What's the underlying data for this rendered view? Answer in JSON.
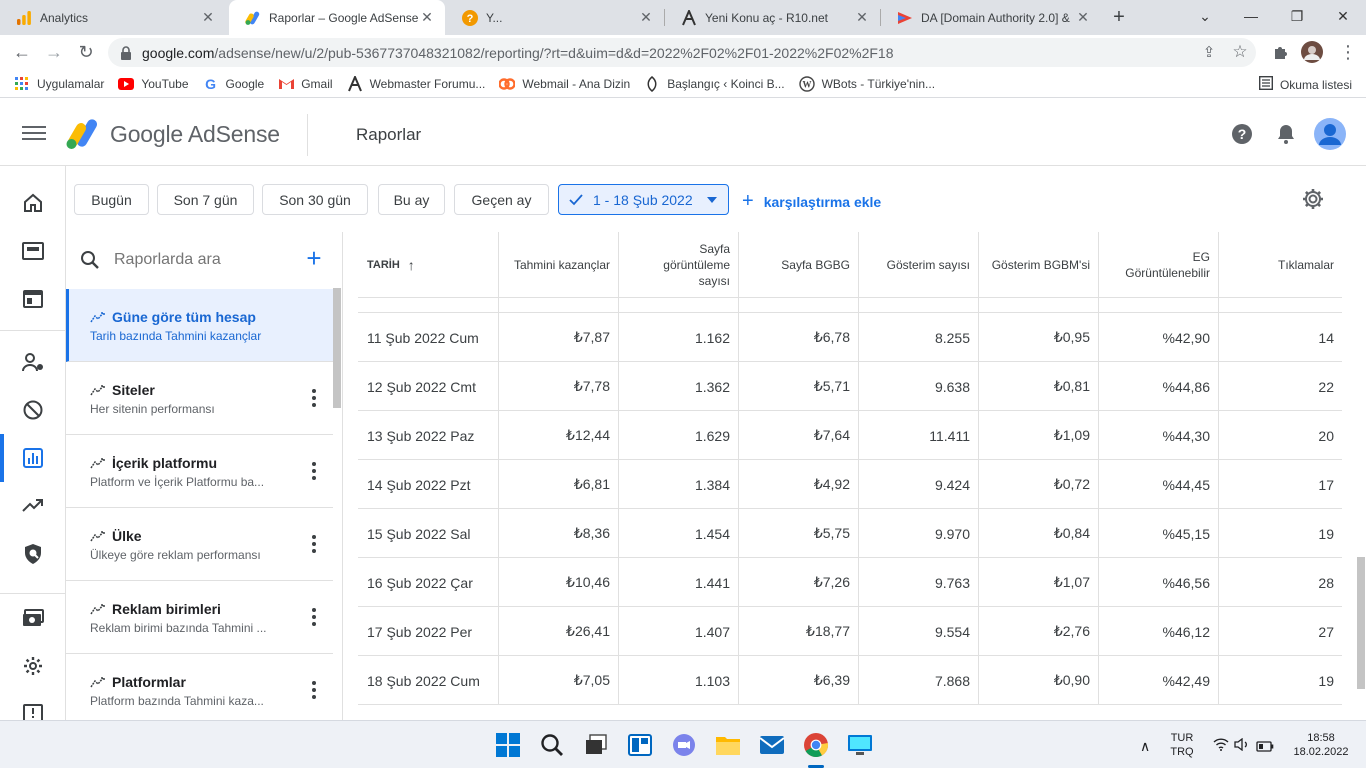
{
  "browser": {
    "tabs": [
      {
        "title": "Analytics",
        "icon": "analytics-icon",
        "active": false
      },
      {
        "title": "Raporlar – Google AdSense",
        "icon": "adsense-icon",
        "active": true
      },
      {
        "title": "Y...",
        "icon": "question-favicon",
        "active": false
      },
      {
        "title": "Yeni Konu aç - R10.net",
        "icon": "r10-favicon",
        "active": false
      },
      {
        "title": "DA [Domain Authority 2.0] &",
        "icon": "da-favicon",
        "active": false
      }
    ],
    "url_domain": "google.com",
    "url_path": "/adsense/new/u/2/pub-5367737048321082/reporting/?rt=d&uim=d&d=2022%2F02%2F01-2022%2F02%2F18",
    "bookmarks": [
      {
        "label": "Uygulamalar",
        "icon": "apps-grid-icon"
      },
      {
        "label": "YouTube",
        "icon": "youtube-icon"
      },
      {
        "label": "Google",
        "icon": "google-icon"
      },
      {
        "label": "Gmail",
        "icon": "gmail-icon"
      },
      {
        "label": "Webmaster Forumu...",
        "icon": "wf-icon"
      },
      {
        "label": "Webmail - Ana Dizin",
        "icon": "cpanel-icon"
      },
      {
        "label": "Başlangıç ‹ Koinci B...",
        "icon": "koinci-icon"
      },
      {
        "label": "WBots - Türkiye'nin...",
        "icon": "wordpress-icon"
      }
    ],
    "reading_list": "Okuma listesi"
  },
  "app": {
    "brand": "Google AdSense",
    "page_title": "Raporlar"
  },
  "filters": {
    "chips": [
      "Bugün",
      "Son 7 gün",
      "Son 30 gün",
      "Bu ay",
      "Geçen ay"
    ],
    "selected_range": "1 - 18 Şub 2022",
    "compare": "karşılaştırma ekle"
  },
  "reports": {
    "search_placeholder": "Raporlarda ara",
    "items": [
      {
        "title": "Güne göre tüm hesap",
        "subtitle": "Tarih bazında Tahmini kazançlar"
      },
      {
        "title": "Siteler",
        "subtitle": "Her sitenin performansı"
      },
      {
        "title": "İçerik platformu",
        "subtitle": "Platform ve İçerik Platformu ba..."
      },
      {
        "title": "Ülke",
        "subtitle": "Ülkeye göre reklam performansı"
      },
      {
        "title": "Reklam birimleri",
        "subtitle": "Reklam birimi bazında Tahmini ..."
      },
      {
        "title": "Platformlar",
        "subtitle": "Platform bazında Tahmini kaza..."
      }
    ]
  },
  "table": {
    "columns": [
      "TARİH",
      "Tahmini kazançlar",
      "Sayfa\ngörüntüleme\nsayısı",
      "Sayfa BGBG",
      "Gösterim sayısı",
      "Gösterim BGBM'si",
      "EG\nGörüntülenebilir",
      "Tıklamalar"
    ],
    "rows": [
      [
        "11 Şub 2022 Cum",
        "₺7,87",
        "1.162",
        "₺6,78",
        "8.255",
        "₺0,95",
        "%42,90",
        "14"
      ],
      [
        "12 Şub 2022 Cmt",
        "₺7,78",
        "1.362",
        "₺5,71",
        "9.638",
        "₺0,81",
        "%44,86",
        "22"
      ],
      [
        "13 Şub 2022 Paz",
        "₺12,44",
        "1.629",
        "₺7,64",
        "11.411",
        "₺1,09",
        "%44,30",
        "20"
      ],
      [
        "14 Şub 2022 Pzt",
        "₺6,81",
        "1.384",
        "₺4,92",
        "9.424",
        "₺0,72",
        "%44,45",
        "17"
      ],
      [
        "15 Şub 2022 Sal",
        "₺8,36",
        "1.454",
        "₺5,75",
        "9.970",
        "₺0,84",
        "%45,15",
        "19"
      ],
      [
        "16 Şub 2022 Çar",
        "₺10,46",
        "1.441",
        "₺7,26",
        "9.763",
        "₺1,07",
        "%46,56",
        "28"
      ],
      [
        "17 Şub 2022 Per",
        "₺26,41",
        "1.407",
        "₺18,77",
        "9.554",
        "₺2,76",
        "%46,12",
        "27"
      ],
      [
        "18 Şub 2022 Cum",
        "₺7,05",
        "1.103",
        "₺6,39",
        "7.868",
        "₺0,90",
        "%42,49",
        "19"
      ]
    ]
  },
  "taskbar": {
    "lang_top": "TUR",
    "lang_bottom": "TRQ",
    "time": "18:58",
    "date": "18.02.2022"
  },
  "colors": {
    "accent": "#1a73e8",
    "selected_bg": "#e8f0fe"
  }
}
